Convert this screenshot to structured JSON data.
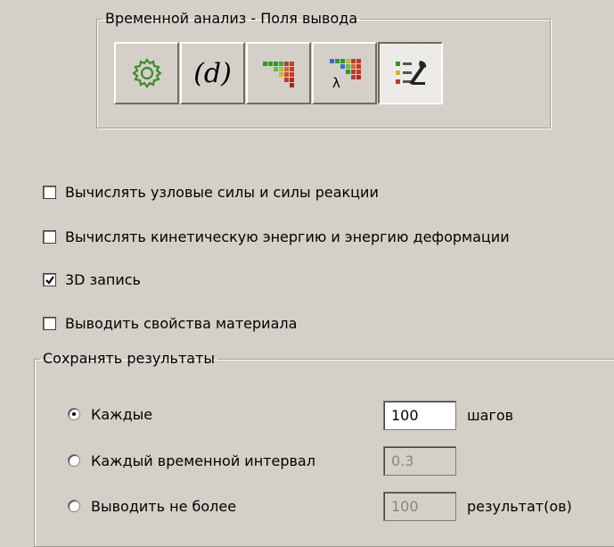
{
  "group_title": "Временной анализ - Поля вывода",
  "toolbar": [
    {
      "name": "gear-icon"
    },
    {
      "label": "(d)"
    },
    {
      "name": "grid-green-red-icon"
    },
    {
      "name": "grid-lambda-icon",
      "lambda": "λ"
    },
    {
      "name": "output-settings-icon"
    }
  ],
  "options": {
    "nodal_forces": {
      "label": "Вычислять узловые силы и силы реакции",
      "checked": false
    },
    "kinetic_energy": {
      "label": "Вычислять кинетическую энергию и энергию деформации",
      "checked": false
    },
    "record_3d": {
      "label": "3D запись",
      "checked": true
    },
    "material_props": {
      "label": "Выводить свойства материала",
      "checked": false
    }
  },
  "save_results": {
    "title": "Сохранять результаты",
    "every": {
      "label": "Каждые",
      "value": "100",
      "unit": "шагов",
      "selected": true
    },
    "interval": {
      "label": "Каждый временной интервал",
      "value": "0.3",
      "selected": false
    },
    "max": {
      "label": "Выводить не более",
      "value": "100",
      "unit": "результат(ов)",
      "selected": false
    }
  },
  "colors": {
    "background": "#d4d0c8",
    "disabled_text": "#8a8782"
  }
}
